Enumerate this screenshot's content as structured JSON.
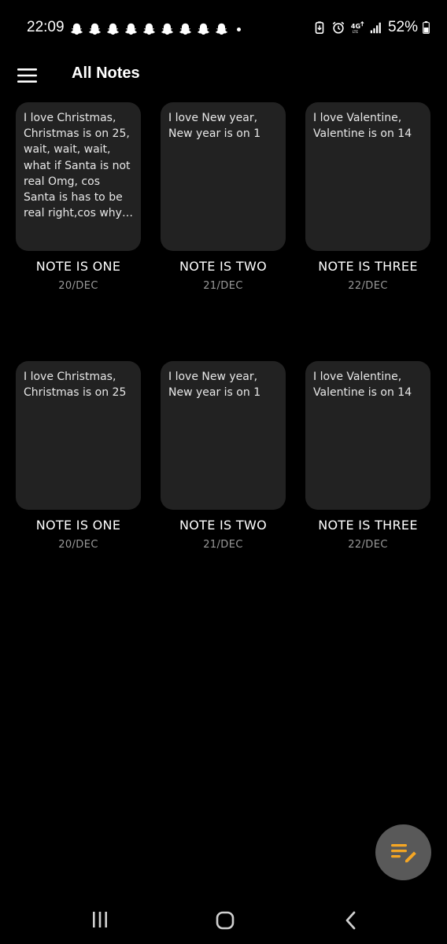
{
  "status_bar": {
    "time": "22:09",
    "notification_icons": [
      "snapchat-icon",
      "snapchat-icon",
      "snapchat-icon",
      "snapchat-icon",
      "snapchat-icon",
      "snapchat-icon",
      "snapchat-icon",
      "snapchat-icon",
      "snapchat-icon"
    ],
    "battery_percent": "52%"
  },
  "header": {
    "title": "All Notes",
    "menu_icon": "hamburger-menu-icon"
  },
  "notes": [
    {
      "preview": "I love Christmas, Christmas is on 25, wait, wait, wait, what if Santa is not real Omg, cos Santa is has to be real right,cos why not. I love Christmas, Christmas",
      "title": "NOTE IS ONE",
      "date": "20/DEC"
    },
    {
      "preview": "I love New year, New year is on 1",
      "title": "NOTE IS TWO",
      "date": "21/DEC"
    },
    {
      "preview": "I love Valentine, Valentine is on 14",
      "title": "NOTE IS THREE",
      "date": "22/DEC"
    },
    {
      "preview": "I love Christmas, Christmas is on 25",
      "title": "NOTE IS ONE",
      "date": "20/DEC"
    },
    {
      "preview": "I love New year, New year is on 1",
      "title": "NOTE IS TWO",
      "date": "21/DEC"
    },
    {
      "preview": "I love Valentine, Valentine is on 14",
      "title": "NOTE IS THREE",
      "date": "22/DEC"
    }
  ],
  "fab": {
    "icon": "compose-note-icon",
    "accent_color": "#f5a623"
  },
  "nav_bar": {
    "icons": [
      "recents-icon",
      "home-icon",
      "back-icon"
    ]
  }
}
